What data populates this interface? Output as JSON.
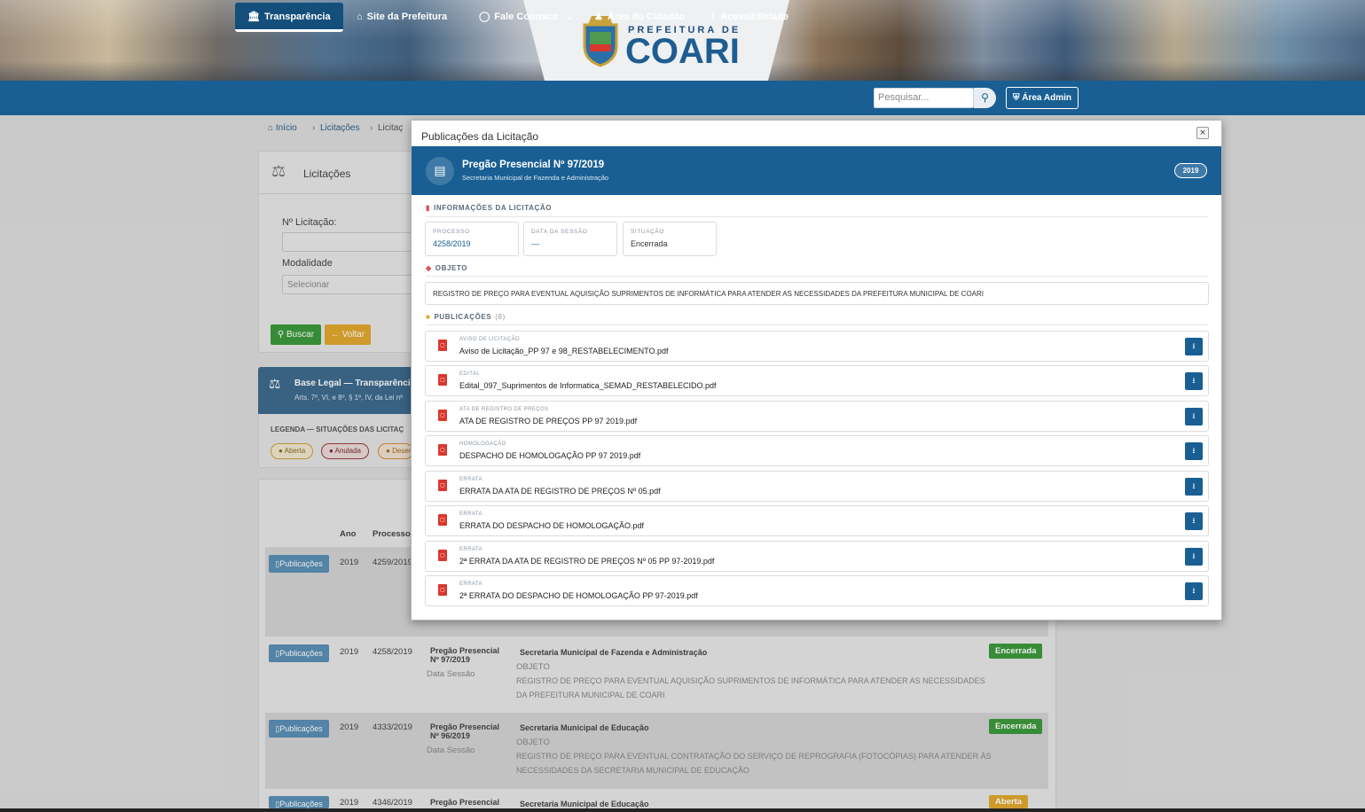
{
  "header": {
    "logo_small": "PREFEITURA DE",
    "logo_big": "COARI"
  },
  "nav": {
    "items": [
      {
        "label": "Transparência",
        "icon": "bank-icon"
      },
      {
        "label": "Site da Prefeitura",
        "icon": "home-icon"
      },
      {
        "label": "Fale Conosco",
        "icon": "headset-icon"
      },
      {
        "label": "Área do Cidadão",
        "icon": "users-icon"
      },
      {
        "label": "Acessibilidade",
        "icon": "accessibility-icon"
      }
    ],
    "search_placeholder": "Pesquisar...",
    "admin_label": "Área Admin"
  },
  "breadcrumb": [
    "Início",
    "Licitações",
    "Licitaç"
  ],
  "filters": {
    "title": "Licitações",
    "numero_label": "Nº Licitação:",
    "modalidade_label": "Modalidade",
    "modalidade_placeholder": "Selecionar",
    "buscar": "Buscar",
    "voltar": "Voltar"
  },
  "legal": {
    "title": "Base Legal — Transparência",
    "subtitle": "Arts. 7º, VI, e 8º, § 1º, IV, da Lei nº",
    "legend_title": "LEGENDA — SITUAÇÕES DAS LICITAÇ",
    "legend": [
      "Aberta",
      "Anulada",
      "Deser"
    ]
  },
  "table": {
    "headers": [
      "Ano",
      "Processo"
    ],
    "button_label": "Publicações",
    "rows": [
      {
        "ano": "2019",
        "processo": "4259/2019"
      },
      {
        "ano": "2019",
        "processo": "4258/2019",
        "modalidade": "Pregão Presencial",
        "numero": "Nº 97/2019",
        "data": "Data Sessão",
        "secretaria": "Secretaria Municipal de Fazenda e Administração",
        "objeto_label": "OBJETO",
        "objeto_1": "REGISTRO DE PREÇO PARA EVENTUAL AQUISIÇÃO SUPRIMENTOS DE INFORMÁTICA PARA ATENDER AS NECESSIDADES",
        "objeto_2": "DA PREFEITURA MUNICIPAL DE COARI",
        "status": "Encerrada"
      },
      {
        "ano": "2019",
        "processo": "4333/2019",
        "modalidade": "Pregão Presencial",
        "numero": "Nº 96/2019",
        "data": "Data Sessão",
        "secretaria": "Secretaria Municipal de Educação",
        "objeto_label": "OBJETO",
        "objeto_1": "REGISTRO DE PREÇO PARA EVENTUAL CONTRATAÇÃO DO SERVIÇO DE REPROGRAFIA (FOTOCÓPIAS) PARA ATENDER ÀS",
        "objeto_2": "NECESSIDADES DA SECRETARIA MUNICIPAL DE EDUCAÇÃO",
        "status": "Encerrada"
      },
      {
        "ano": "2019",
        "processo": "4346/2019",
        "modalidade": "Pregão Presencial",
        "secretaria": "Secretaria Municipal de Educação",
        "status": "Aberta"
      }
    ]
  },
  "modal": {
    "title": "Publicações da Licitação",
    "close": "×",
    "heading": "Pregão Presencial Nº 97/2019",
    "subheading": "Secretaria Municipal de Fazenda e Administração",
    "year": "2019",
    "info_title": "INFORMAÇÕES DA LICITAÇÃO",
    "info": [
      {
        "key": "PROCESSO",
        "value": "4258/2019"
      },
      {
        "key": "DATA DA SESSÃO",
        "value": "—"
      },
      {
        "key": "SITUAÇÃO",
        "value": "Encerrada"
      }
    ],
    "objeto_title": "OBJETO",
    "objeto": "REGISTRO DE PREÇO PARA EVENTUAL AQUISIÇÃO SUPRIMENTOS DE INFORMÁTICA PARA ATENDER AS NECESSIDADES DA PREFEITURA MUNICIPAL DE COARI",
    "pub_title": "PUBLICAÇÕES",
    "pub_count": "(8)",
    "docs": [
      {
        "type": "AVISO DE LICITAÇÃO",
        "name": "Aviso de Licitação_PP 97 e 98_RESTABELECIMENTO.pdf"
      },
      {
        "type": "EDITAL",
        "name": "Edital_097_Suprimentos de Informatica_SEMAD_RESTABELECIDO.pdf"
      },
      {
        "type": "ATA DE REGISTRO DE PREÇOS",
        "name": "ATA DE REGISTRO DE PREÇOS PP 97 2019.pdf"
      },
      {
        "type": "HOMOLOGAÇÃO",
        "name": "DESPACHO DE HOMOLOGAÇÃO PP 97 2019.pdf"
      },
      {
        "type": "ERRATA",
        "name": "ERRATA DA ATA DE REGISTRO DE PREÇOS Nº 05.pdf"
      },
      {
        "type": "ERRATA",
        "name": "ERRATA DO DESPACHO DE HOMOLOGAÇÃO.pdf"
      },
      {
        "type": "ERRATA",
        "name": "2ª ERRATA DA ATA DE REGISTRO DE PREÇOS Nº 05 PP 97-2019.pdf"
      },
      {
        "type": "ERRATA",
        "name": "2ª ERRATA DO DESPACHO DE HOMOLOGAÇÃO PP 97-2019.pdf"
      }
    ]
  },
  "colors": {
    "primary": "#195f94",
    "success": "#3c9a3c",
    "warning": "#e0a82e",
    "pdf": "#d9372d"
  }
}
